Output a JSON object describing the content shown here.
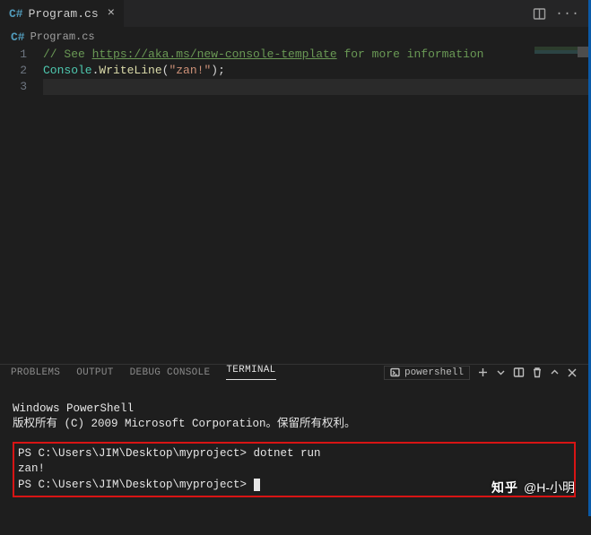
{
  "tab": {
    "icon_label": "C#",
    "filename": "Program.cs"
  },
  "breadcrumb": {
    "icon_label": "C#",
    "filename": "Program.cs"
  },
  "code": {
    "lines": [
      {
        "num": "1",
        "segments": [
          {
            "cls": "tk-comment",
            "text": "// See "
          },
          {
            "cls": "tk-url",
            "text": "https://aka.ms/new-console-template"
          },
          {
            "cls": "tk-comment",
            "text": " for more information"
          }
        ]
      },
      {
        "num": "2",
        "segments": [
          {
            "cls": "tk-type",
            "text": "Console"
          },
          {
            "cls": "tk-punc",
            "text": "."
          },
          {
            "cls": "tk-method",
            "text": "WriteLine"
          },
          {
            "cls": "tk-punc",
            "text": "("
          },
          {
            "cls": "tk-string",
            "text": "\"zan!\""
          },
          {
            "cls": "tk-punc",
            "text": ");"
          }
        ]
      },
      {
        "num": "3",
        "segments": []
      }
    ]
  },
  "panel": {
    "tabs": {
      "problems": "PROBLEMS",
      "output": "OUTPUT",
      "debug": "DEBUG CONSOLE",
      "terminal": "TERMINAL"
    },
    "dropdown": {
      "icon": "powershell-icon",
      "label": "powershell"
    }
  },
  "terminal": {
    "header1": "Windows PowerShell",
    "header2": "版权所有 (C) 2009 Microsoft Corporation。保留所有权利。",
    "line1": "PS C:\\Users\\JIM\\Desktop\\myproject> dotnet run",
    "line2": "zan!",
    "line3": "PS C:\\Users\\JIM\\Desktop\\myproject> "
  },
  "watermark": {
    "brand": "知乎",
    "user": "@H-小明"
  }
}
